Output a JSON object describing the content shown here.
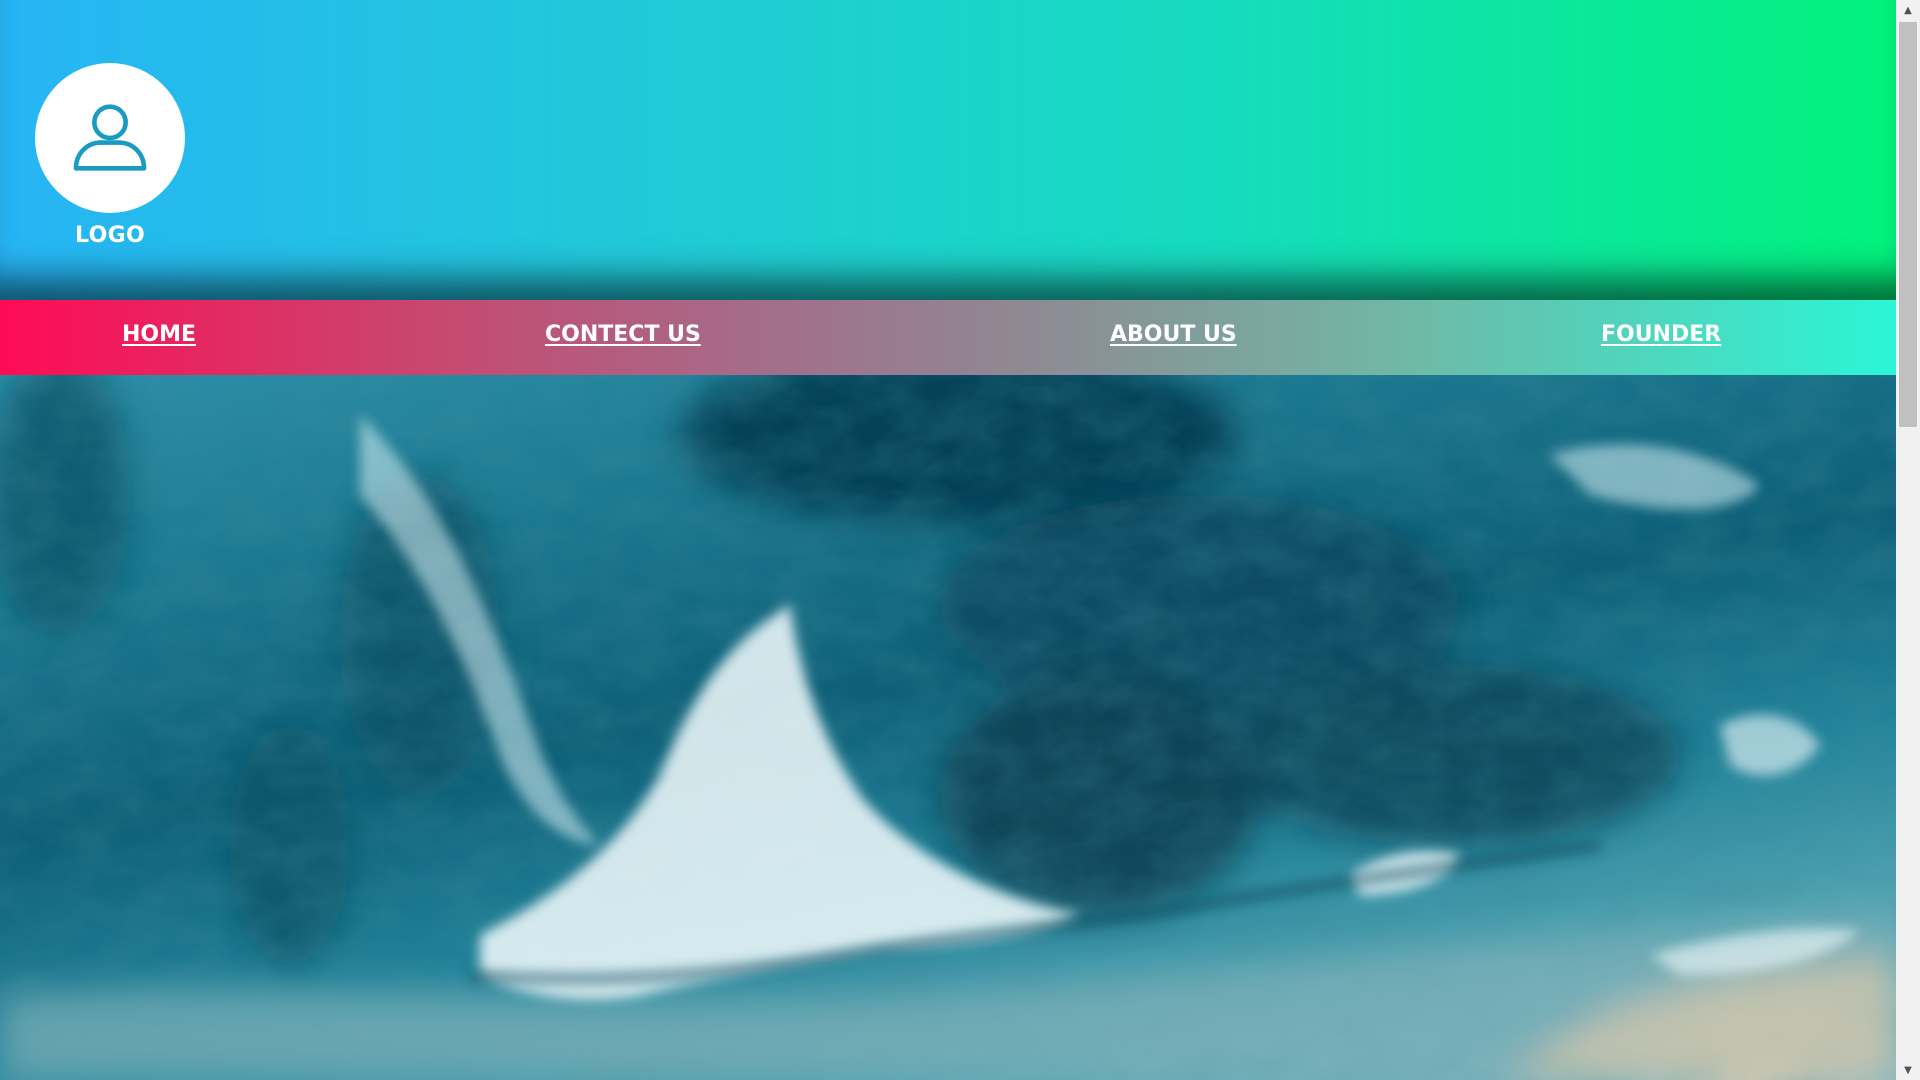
{
  "header": {
    "logo_label": "LOGO",
    "logo_icon": "user-icon",
    "gradient_colors": [
      "#26b5f5",
      "#21cad7",
      "#02f27c"
    ]
  },
  "nav": {
    "items": [
      {
        "label": "HOME"
      },
      {
        "label": "CONTECT US"
      },
      {
        "label": "ABOUT US"
      },
      {
        "label": "FOUNDER"
      }
    ],
    "gradient_colors": [
      "#ff0b55",
      "#8d8b94",
      "#2af6d6"
    ]
  },
  "hero": {
    "subject": "ocean waves on beach"
  },
  "scrollbar": {
    "up_icon": "arrow-up-icon",
    "down_icon": "arrow-down-icon"
  }
}
